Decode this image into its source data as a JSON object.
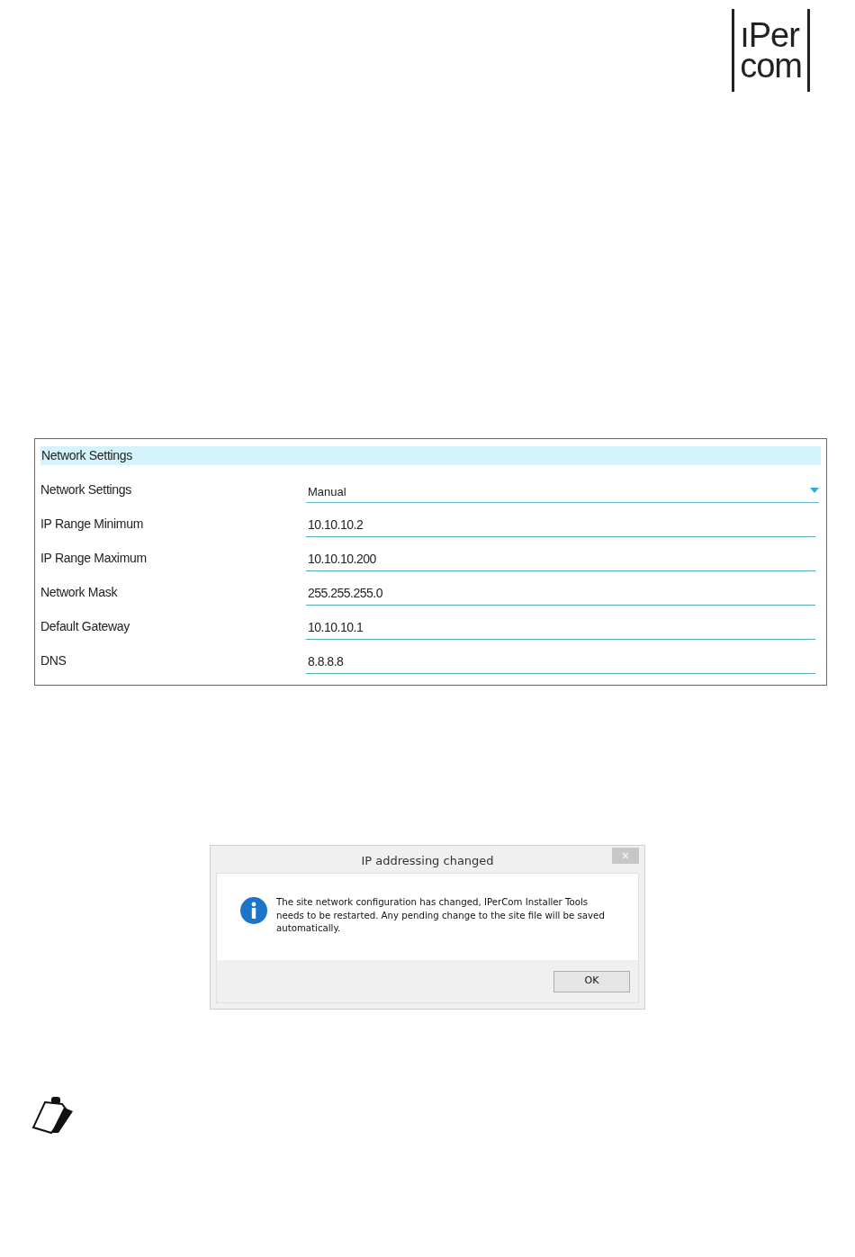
{
  "logo": {
    "lines": [
      "ıPer",
      "com"
    ]
  },
  "network_panel": {
    "header": "Network Settings",
    "fields": [
      {
        "kind": "dropdown",
        "label": "Network Settings",
        "value": "Manual"
      },
      {
        "kind": "text",
        "label": "IP Range Minimum",
        "value": "10.10.10.2"
      },
      {
        "kind": "text",
        "label": "IP Range Maximum",
        "value": "10.10.10.200"
      },
      {
        "kind": "text",
        "label": "Network Mask",
        "value": "255.255.255.0"
      },
      {
        "kind": "text",
        "label": "Default Gateway",
        "value": "10.10.10.1"
      },
      {
        "kind": "text",
        "label": "DNS",
        "value": "8.8.8.8"
      }
    ]
  },
  "dialog": {
    "title": "IP addressing changed",
    "close": "×",
    "message": "The site network configuration has changed, IPerCom Installer Tools needs to be restarted. Any pending change to the site file will be saved automatically.",
    "buttons": [
      "OK"
    ]
  }
}
